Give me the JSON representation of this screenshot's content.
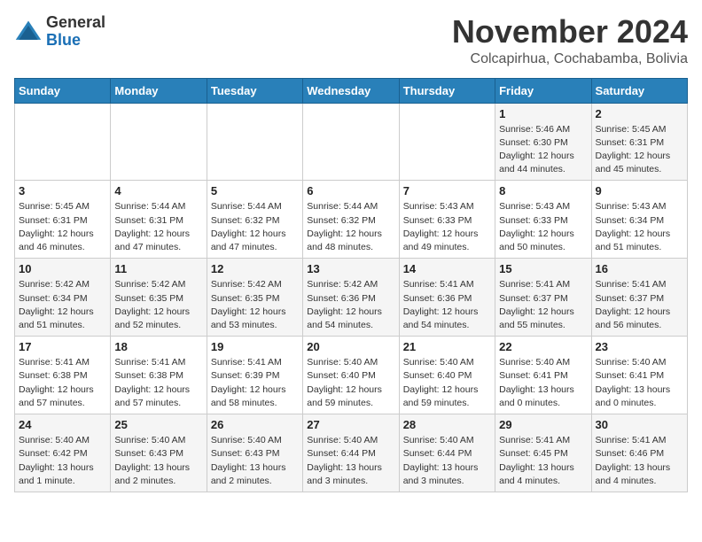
{
  "header": {
    "logo_line1": "General",
    "logo_line2": "Blue",
    "month_title": "November 2024",
    "subtitle": "Colcapirhua, Cochabamba, Bolivia"
  },
  "days_of_week": [
    "Sunday",
    "Monday",
    "Tuesday",
    "Wednesday",
    "Thursday",
    "Friday",
    "Saturday"
  ],
  "weeks": [
    [
      {
        "day": "",
        "info": ""
      },
      {
        "day": "",
        "info": ""
      },
      {
        "day": "",
        "info": ""
      },
      {
        "day": "",
        "info": ""
      },
      {
        "day": "",
        "info": ""
      },
      {
        "day": "1",
        "info": "Sunrise: 5:46 AM\nSunset: 6:30 PM\nDaylight: 12 hours\nand 44 minutes."
      },
      {
        "day": "2",
        "info": "Sunrise: 5:45 AM\nSunset: 6:31 PM\nDaylight: 12 hours\nand 45 minutes."
      }
    ],
    [
      {
        "day": "3",
        "info": "Sunrise: 5:45 AM\nSunset: 6:31 PM\nDaylight: 12 hours\nand 46 minutes."
      },
      {
        "day": "4",
        "info": "Sunrise: 5:44 AM\nSunset: 6:31 PM\nDaylight: 12 hours\nand 47 minutes."
      },
      {
        "day": "5",
        "info": "Sunrise: 5:44 AM\nSunset: 6:32 PM\nDaylight: 12 hours\nand 47 minutes."
      },
      {
        "day": "6",
        "info": "Sunrise: 5:44 AM\nSunset: 6:32 PM\nDaylight: 12 hours\nand 48 minutes."
      },
      {
        "day": "7",
        "info": "Sunrise: 5:43 AM\nSunset: 6:33 PM\nDaylight: 12 hours\nand 49 minutes."
      },
      {
        "day": "8",
        "info": "Sunrise: 5:43 AM\nSunset: 6:33 PM\nDaylight: 12 hours\nand 50 minutes."
      },
      {
        "day": "9",
        "info": "Sunrise: 5:43 AM\nSunset: 6:34 PM\nDaylight: 12 hours\nand 51 minutes."
      }
    ],
    [
      {
        "day": "10",
        "info": "Sunrise: 5:42 AM\nSunset: 6:34 PM\nDaylight: 12 hours\nand 51 minutes."
      },
      {
        "day": "11",
        "info": "Sunrise: 5:42 AM\nSunset: 6:35 PM\nDaylight: 12 hours\nand 52 minutes."
      },
      {
        "day": "12",
        "info": "Sunrise: 5:42 AM\nSunset: 6:35 PM\nDaylight: 12 hours\nand 53 minutes."
      },
      {
        "day": "13",
        "info": "Sunrise: 5:42 AM\nSunset: 6:36 PM\nDaylight: 12 hours\nand 54 minutes."
      },
      {
        "day": "14",
        "info": "Sunrise: 5:41 AM\nSunset: 6:36 PM\nDaylight: 12 hours\nand 54 minutes."
      },
      {
        "day": "15",
        "info": "Sunrise: 5:41 AM\nSunset: 6:37 PM\nDaylight: 12 hours\nand 55 minutes."
      },
      {
        "day": "16",
        "info": "Sunrise: 5:41 AM\nSunset: 6:37 PM\nDaylight: 12 hours\nand 56 minutes."
      }
    ],
    [
      {
        "day": "17",
        "info": "Sunrise: 5:41 AM\nSunset: 6:38 PM\nDaylight: 12 hours\nand 57 minutes."
      },
      {
        "day": "18",
        "info": "Sunrise: 5:41 AM\nSunset: 6:38 PM\nDaylight: 12 hours\nand 57 minutes."
      },
      {
        "day": "19",
        "info": "Sunrise: 5:41 AM\nSunset: 6:39 PM\nDaylight: 12 hours\nand 58 minutes."
      },
      {
        "day": "20",
        "info": "Sunrise: 5:40 AM\nSunset: 6:40 PM\nDaylight: 12 hours\nand 59 minutes."
      },
      {
        "day": "21",
        "info": "Sunrise: 5:40 AM\nSunset: 6:40 PM\nDaylight: 12 hours\nand 59 minutes."
      },
      {
        "day": "22",
        "info": "Sunrise: 5:40 AM\nSunset: 6:41 PM\nDaylight: 13 hours\nand 0 minutes."
      },
      {
        "day": "23",
        "info": "Sunrise: 5:40 AM\nSunset: 6:41 PM\nDaylight: 13 hours\nand 0 minutes."
      }
    ],
    [
      {
        "day": "24",
        "info": "Sunrise: 5:40 AM\nSunset: 6:42 PM\nDaylight: 13 hours\nand 1 minute."
      },
      {
        "day": "25",
        "info": "Sunrise: 5:40 AM\nSunset: 6:43 PM\nDaylight: 13 hours\nand 2 minutes."
      },
      {
        "day": "26",
        "info": "Sunrise: 5:40 AM\nSunset: 6:43 PM\nDaylight: 13 hours\nand 2 minutes."
      },
      {
        "day": "27",
        "info": "Sunrise: 5:40 AM\nSunset: 6:44 PM\nDaylight: 13 hours\nand 3 minutes."
      },
      {
        "day": "28",
        "info": "Sunrise: 5:40 AM\nSunset: 6:44 PM\nDaylight: 13 hours\nand 3 minutes."
      },
      {
        "day": "29",
        "info": "Sunrise: 5:41 AM\nSunset: 6:45 PM\nDaylight: 13 hours\nand 4 minutes."
      },
      {
        "day": "30",
        "info": "Sunrise: 5:41 AM\nSunset: 6:46 PM\nDaylight: 13 hours\nand 4 minutes."
      }
    ]
  ]
}
